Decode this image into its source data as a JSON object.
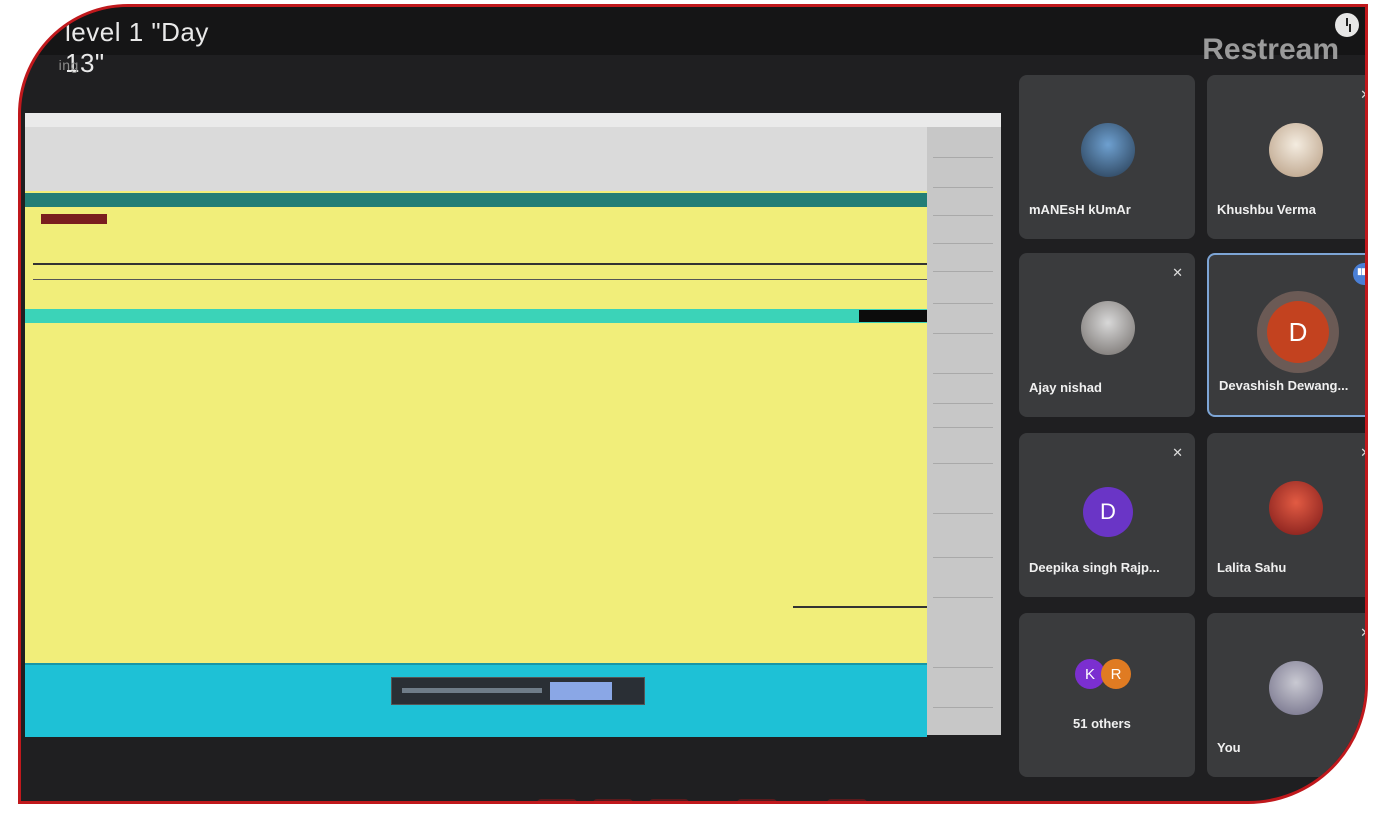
{
  "stream": {
    "title": "level 1 \"Day 13\"",
    "title_suffix": "ing",
    "brand": "Restream"
  },
  "participants": [
    {
      "name": "mANEsH kUmAr",
      "kind": "photo",
      "muted": false
    },
    {
      "name": "Khushbu Verma",
      "kind": "photo",
      "muted": true
    },
    {
      "name": "Ajay nishad",
      "kind": "photo",
      "muted": true
    },
    {
      "name": "Devashish Dewang...",
      "kind": "initial",
      "initial": "D",
      "color": "#c3421f",
      "muted": false,
      "speaking": true
    },
    {
      "name": "Deepika singh Rajp...",
      "kind": "initial",
      "initial": "D",
      "color": "#6a35c6",
      "muted": true
    },
    {
      "name": "Lalita Sahu",
      "kind": "photo",
      "muted": true
    },
    {
      "name": "51 others",
      "kind": "group",
      "initials": [
        "K",
        "R"
      ],
      "colors": [
        "#7b2fd0",
        "#e07b22"
      ]
    },
    {
      "name": "You",
      "kind": "photo",
      "muted": true
    }
  ],
  "colors": {
    "frame_border": "#c0181c",
    "tally_bg": "#f1ee7a",
    "tally_teal": "#237e76",
    "tally_mint": "#3bd3b8",
    "taskbar_cyan": "#1ec1d6"
  }
}
